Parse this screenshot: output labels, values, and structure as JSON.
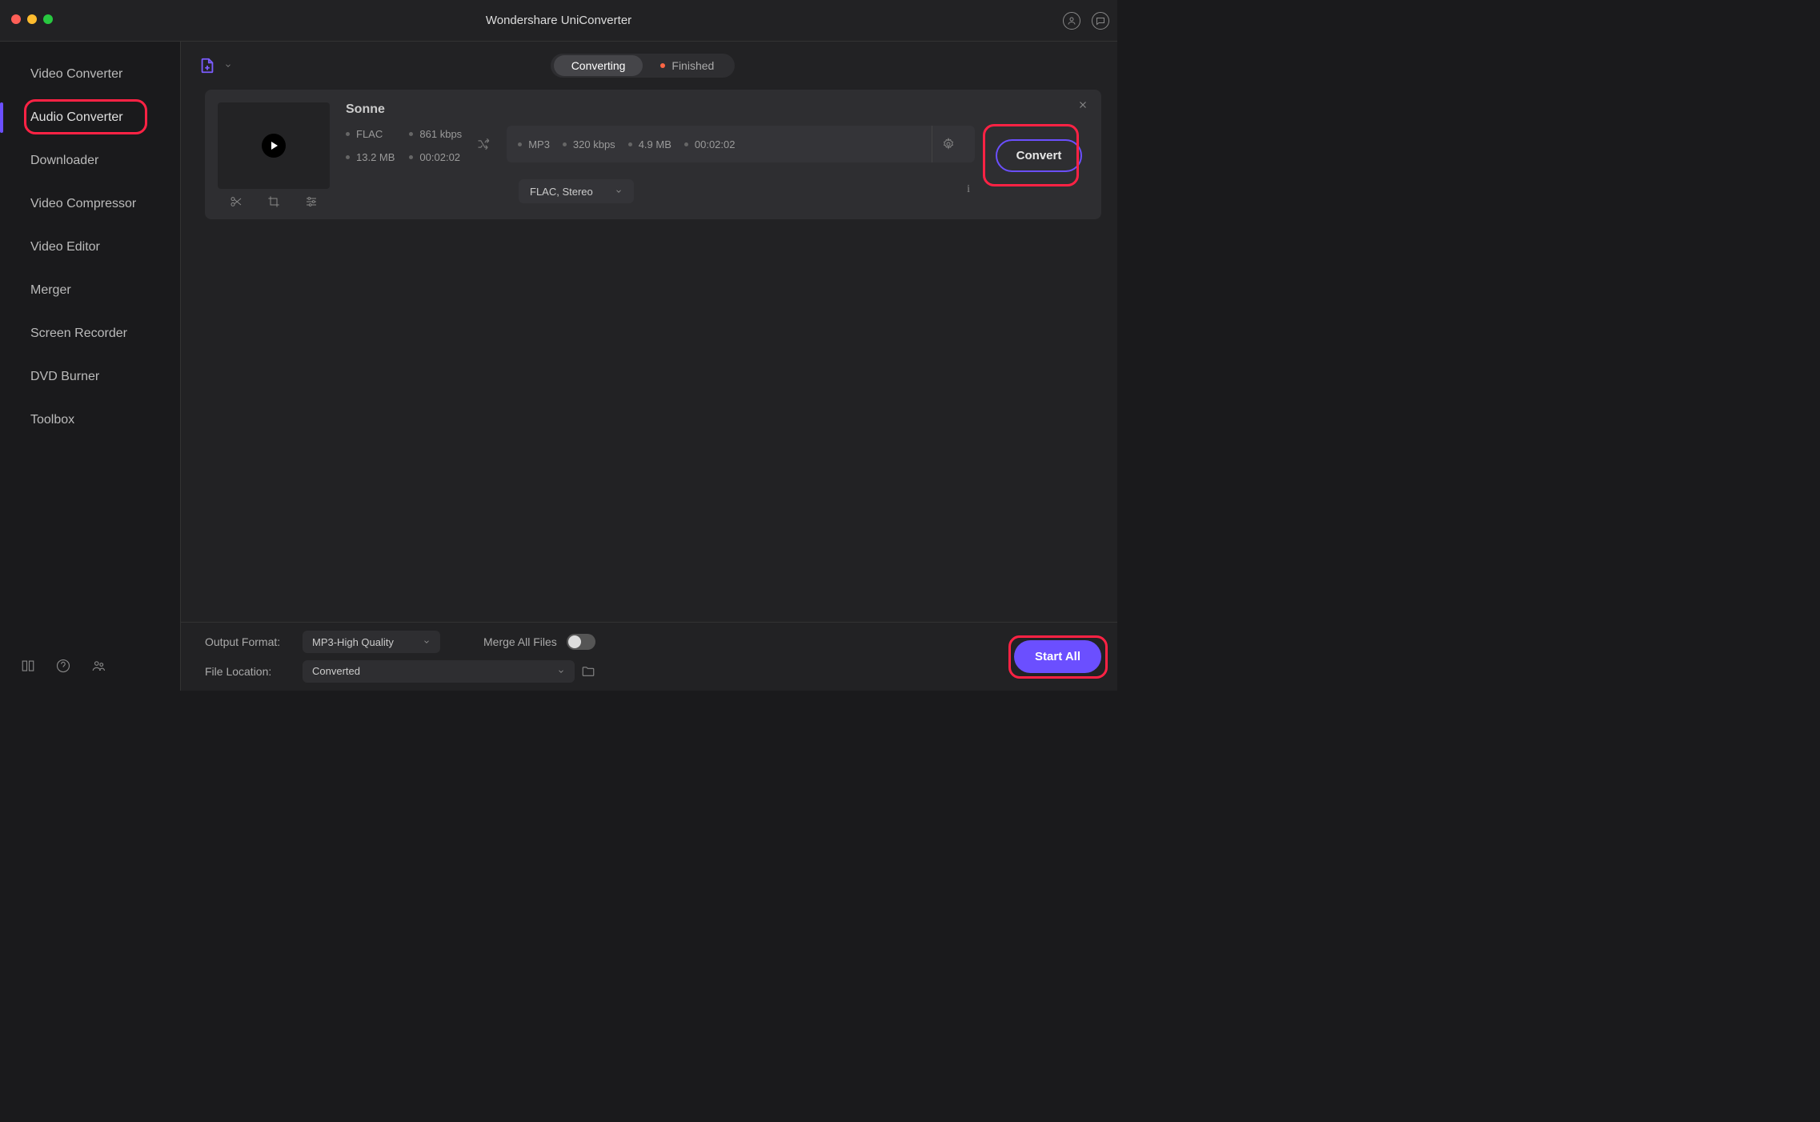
{
  "title": "Wondershare UniConverter",
  "sidebar": {
    "items": [
      {
        "label": "Video Converter"
      },
      {
        "label": "Audio Converter"
      },
      {
        "label": "Downloader"
      },
      {
        "label": "Video Compressor"
      },
      {
        "label": "Video Editor"
      },
      {
        "label": "Merger"
      },
      {
        "label": "Screen Recorder"
      },
      {
        "label": "DVD Burner"
      },
      {
        "label": "Toolbox"
      }
    ]
  },
  "tabs": {
    "converting": "Converting",
    "finished": "Finished"
  },
  "file": {
    "title": "Sonne",
    "src_format": "FLAC",
    "src_bitrate": "861 kbps",
    "src_size": "13.2 MB",
    "src_duration": "00:02:02",
    "dst_format": "MP3",
    "dst_bitrate": "320 kbps",
    "dst_size": "4.9 MB",
    "dst_duration": "00:02:02",
    "format_select": "FLAC, Stereo",
    "convert_label": "Convert"
  },
  "bottom": {
    "output_format_label": "Output Format:",
    "output_format_value": "MP3-High Quality",
    "file_location_label": "File Location:",
    "file_location_value": "Converted",
    "merge_label": "Merge All Files",
    "start_all_label": "Start All"
  }
}
